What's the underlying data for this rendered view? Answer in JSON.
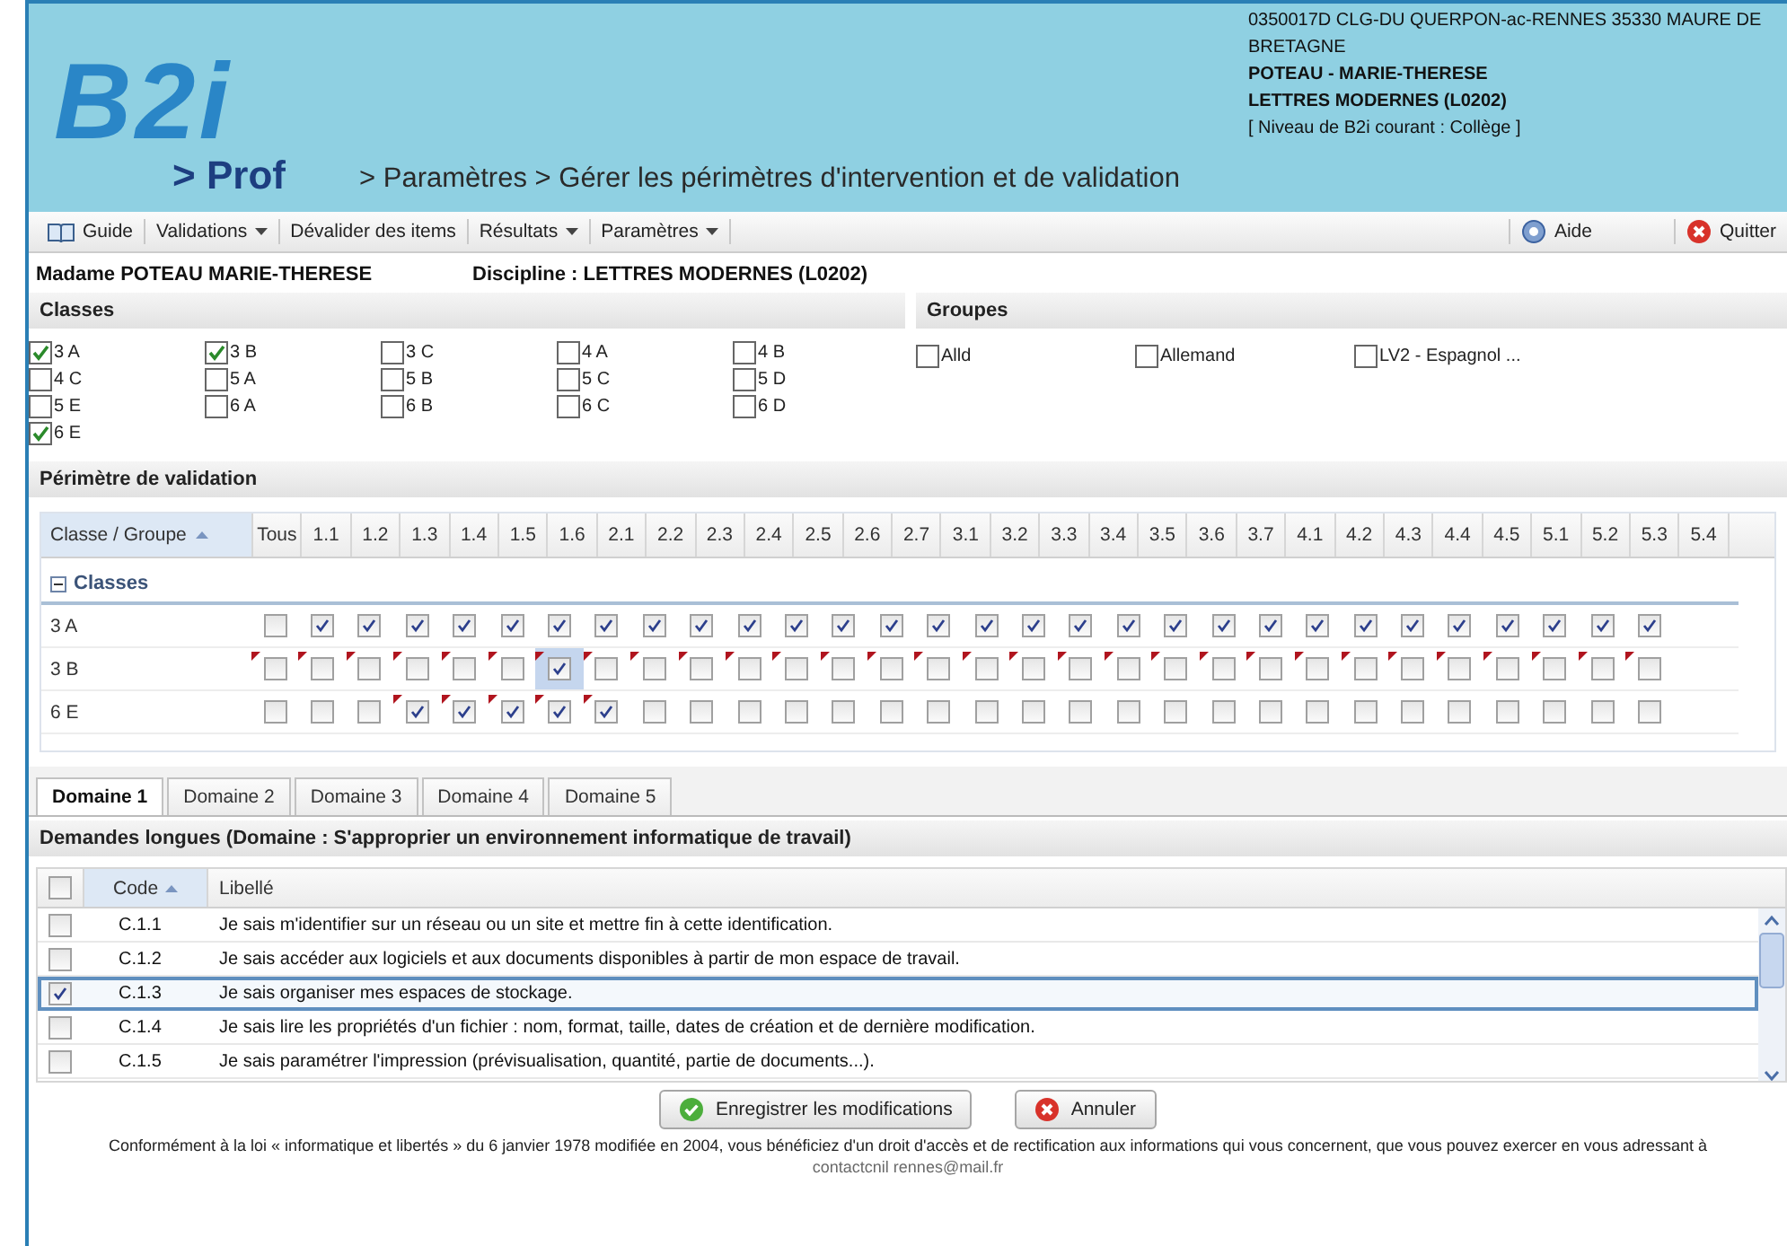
{
  "header": {
    "logo": "B2i",
    "logo_sub": "> Prof",
    "breadcrumb": "> Paramètres > Gérer les périmètres d'intervention et de validation",
    "school": "0350017D CLG-DU QUERPON-ac-RENNES 35330 MAURE DE BRETAGNE",
    "name": "POTEAU - MARIE-THERESE",
    "discipline": "LETTRES MODERNES (L0202)",
    "level": "[ Niveau de B2i courant : Collège ]"
  },
  "toolbar": {
    "left": [
      {
        "label": "Guide",
        "kind": "book"
      },
      {
        "label": "Validations",
        "kind": "menu"
      },
      {
        "label": "Dévalider des items",
        "kind": "plain"
      },
      {
        "label": "Résultats",
        "kind": "menu"
      },
      {
        "label": "Paramètres",
        "kind": "menu"
      }
    ],
    "right": [
      {
        "label": "Aide",
        "kind": "help"
      },
      {
        "label": "Quitter",
        "kind": "quit"
      }
    ]
  },
  "teacher": "Madame POTEAU MARIE-THERESE",
  "discipline": "Discipline : LETTRES MODERNES (L0202)",
  "classes": {
    "title": "Classes",
    "items": [
      {
        "label": "3 A",
        "checked": true
      },
      {
        "label": "3 B",
        "checked": true
      },
      {
        "label": "3 C",
        "checked": false
      },
      {
        "label": "4 A",
        "checked": false
      },
      {
        "label": "4 B",
        "checked": false
      },
      {
        "label": "4 C",
        "checked": false
      },
      {
        "label": "5 A",
        "checked": false
      },
      {
        "label": "5 B",
        "checked": false
      },
      {
        "label": "5 C",
        "checked": false
      },
      {
        "label": "5 D",
        "checked": false
      },
      {
        "label": "5 E",
        "checked": false
      },
      {
        "label": "6 A",
        "checked": false
      },
      {
        "label": "6 B",
        "checked": false
      },
      {
        "label": "6 C",
        "checked": false
      },
      {
        "label": "6 D",
        "checked": false
      },
      {
        "label": "6 E",
        "checked": true
      }
    ]
  },
  "groups": {
    "title": "Groupes",
    "items": [
      {
        "label": "Alld",
        "checked": false
      },
      {
        "label": "Allemand",
        "checked": false
      },
      {
        "label": "LV2 - Espagnol ...",
        "checked": false
      }
    ]
  },
  "validation": {
    "title": "Périmètre de validation",
    "first_column": "Classe / Groupe",
    "columns": [
      "Tous",
      "1.1",
      "1.2",
      "1.3",
      "1.4",
      "1.5",
      "1.6",
      "2.1",
      "2.2",
      "2.3",
      "2.4",
      "2.5",
      "2.6",
      "2.7",
      "3.1",
      "3.2",
      "3.3",
      "3.4",
      "3.5",
      "3.6",
      "3.7",
      "4.1",
      "4.2",
      "4.3",
      "4.4",
      "4.5",
      "5.1",
      "5.2",
      "5.3",
      "5.4"
    ],
    "group": "Classes",
    "rows": [
      {
        "label": "3 A",
        "cells": [
          {
            "checked": false,
            "dirty": false,
            "selected": false
          },
          {
            "checked": true,
            "dirty": false,
            "selected": false
          },
          {
            "checked": true,
            "dirty": false,
            "selected": false
          },
          {
            "checked": true,
            "dirty": false,
            "selected": false
          },
          {
            "checked": true,
            "dirty": false,
            "selected": false
          },
          {
            "checked": true,
            "dirty": false,
            "selected": false
          },
          {
            "checked": true,
            "dirty": false,
            "selected": false
          },
          {
            "checked": true,
            "dirty": false,
            "selected": false
          },
          {
            "checked": true,
            "dirty": false,
            "selected": false
          },
          {
            "checked": true,
            "dirty": false,
            "selected": false
          },
          {
            "checked": true,
            "dirty": false,
            "selected": false
          },
          {
            "checked": true,
            "dirty": false,
            "selected": false
          },
          {
            "checked": true,
            "dirty": false,
            "selected": false
          },
          {
            "checked": true,
            "dirty": false,
            "selected": false
          },
          {
            "checked": true,
            "dirty": false,
            "selected": false
          },
          {
            "checked": true,
            "dirty": false,
            "selected": false
          },
          {
            "checked": true,
            "dirty": false,
            "selected": false
          },
          {
            "checked": true,
            "dirty": false,
            "selected": false
          },
          {
            "checked": true,
            "dirty": false,
            "selected": false
          },
          {
            "checked": true,
            "dirty": false,
            "selected": false
          },
          {
            "checked": true,
            "dirty": false,
            "selected": false
          },
          {
            "checked": true,
            "dirty": false,
            "selected": false
          },
          {
            "checked": true,
            "dirty": false,
            "selected": false
          },
          {
            "checked": true,
            "dirty": false,
            "selected": false
          },
          {
            "checked": true,
            "dirty": false,
            "selected": false
          },
          {
            "checked": true,
            "dirty": false,
            "selected": false
          },
          {
            "checked": true,
            "dirty": false,
            "selected": false
          },
          {
            "checked": true,
            "dirty": false,
            "selected": false
          },
          {
            "checked": true,
            "dirty": false,
            "selected": false
          },
          {
            "checked": true,
            "dirty": false,
            "selected": false
          }
        ]
      },
      {
        "label": "3 B",
        "cells": [
          {
            "checked": false,
            "dirty": true,
            "selected": false
          },
          {
            "checked": false,
            "dirty": true,
            "selected": false
          },
          {
            "checked": false,
            "dirty": true,
            "selected": false
          },
          {
            "checked": false,
            "dirty": true,
            "selected": false
          },
          {
            "checked": false,
            "dirty": true,
            "selected": false
          },
          {
            "checked": false,
            "dirty": true,
            "selected": false
          },
          {
            "checked": true,
            "dirty": true,
            "selected": true
          },
          {
            "checked": false,
            "dirty": true,
            "selected": false
          },
          {
            "checked": false,
            "dirty": true,
            "selected": false
          },
          {
            "checked": false,
            "dirty": true,
            "selected": false
          },
          {
            "checked": false,
            "dirty": true,
            "selected": false
          },
          {
            "checked": false,
            "dirty": true,
            "selected": false
          },
          {
            "checked": false,
            "dirty": true,
            "selected": false
          },
          {
            "checked": false,
            "dirty": true,
            "selected": false
          },
          {
            "checked": false,
            "dirty": true,
            "selected": false
          },
          {
            "checked": false,
            "dirty": true,
            "selected": false
          },
          {
            "checked": false,
            "dirty": true,
            "selected": false
          },
          {
            "checked": false,
            "dirty": true,
            "selected": false
          },
          {
            "checked": false,
            "dirty": true,
            "selected": false
          },
          {
            "checked": false,
            "dirty": true,
            "selected": false
          },
          {
            "checked": false,
            "dirty": true,
            "selected": false
          },
          {
            "checked": false,
            "dirty": true,
            "selected": false
          },
          {
            "checked": false,
            "dirty": true,
            "selected": false
          },
          {
            "checked": false,
            "dirty": true,
            "selected": false
          },
          {
            "checked": false,
            "dirty": true,
            "selected": false
          },
          {
            "checked": false,
            "dirty": true,
            "selected": false
          },
          {
            "checked": false,
            "dirty": true,
            "selected": false
          },
          {
            "checked": false,
            "dirty": true,
            "selected": false
          },
          {
            "checked": false,
            "dirty": true,
            "selected": false
          },
          {
            "checked": false,
            "dirty": true,
            "selected": false
          }
        ]
      },
      {
        "label": "6 E",
        "cells": [
          {
            "checked": false,
            "dirty": false,
            "selected": false
          },
          {
            "checked": false,
            "dirty": false,
            "selected": false
          },
          {
            "checked": false,
            "dirty": false,
            "selected": false
          },
          {
            "checked": true,
            "dirty": true,
            "selected": false
          },
          {
            "checked": true,
            "dirty": true,
            "selected": false
          },
          {
            "checked": true,
            "dirty": true,
            "selected": false
          },
          {
            "checked": true,
            "dirty": true,
            "selected": false
          },
          {
            "checked": true,
            "dirty": true,
            "selected": false
          },
          {
            "checked": false,
            "dirty": false,
            "selected": false
          },
          {
            "checked": false,
            "dirty": false,
            "selected": false
          },
          {
            "checked": false,
            "dirty": false,
            "selected": false
          },
          {
            "checked": false,
            "dirty": false,
            "selected": false
          },
          {
            "checked": false,
            "dirty": false,
            "selected": false
          },
          {
            "checked": false,
            "dirty": false,
            "selected": false
          },
          {
            "checked": false,
            "dirty": false,
            "selected": false
          },
          {
            "checked": false,
            "dirty": false,
            "selected": false
          },
          {
            "checked": false,
            "dirty": false,
            "selected": false
          },
          {
            "checked": false,
            "dirty": false,
            "selected": false
          },
          {
            "checked": false,
            "dirty": false,
            "selected": false
          },
          {
            "checked": false,
            "dirty": false,
            "selected": false
          },
          {
            "checked": false,
            "dirty": false,
            "selected": false
          },
          {
            "checked": false,
            "dirty": false,
            "selected": false
          },
          {
            "checked": false,
            "dirty": false,
            "selected": false
          },
          {
            "checked": false,
            "dirty": false,
            "selected": false
          },
          {
            "checked": false,
            "dirty": false,
            "selected": false
          },
          {
            "checked": false,
            "dirty": false,
            "selected": false
          },
          {
            "checked": false,
            "dirty": false,
            "selected": false
          },
          {
            "checked": false,
            "dirty": false,
            "selected": false
          },
          {
            "checked": false,
            "dirty": false,
            "selected": false
          },
          {
            "checked": false,
            "dirty": false,
            "selected": false
          }
        ]
      }
    ]
  },
  "domain_tabs": [
    {
      "label": "Domaine 1",
      "selected": true
    },
    {
      "label": "Domaine 2",
      "selected": false
    },
    {
      "label": "Domaine 3",
      "selected": false
    },
    {
      "label": "Domaine 4",
      "selected": false
    },
    {
      "label": "Domaine 5",
      "selected": false
    }
  ],
  "demands": {
    "all_checked": false,
    "title": "Demandes longues (Domaine : S'approprier un environnement informatique de travail)",
    "columns": [
      "Code",
      "Libellé"
    ],
    "rows": [
      {
        "code": "C.1.1",
        "label": "Je sais m'identifier sur un réseau ou un site et mettre fin à cette identification.",
        "checked": false,
        "selected": false
      },
      {
        "code": "C.1.2",
        "label": "Je sais accéder aux logiciels et aux documents disponibles à partir de mon espace de travail.",
        "checked": false,
        "selected": false
      },
      {
        "code": "C.1.3",
        "label": "Je sais organiser mes espaces de stockage.",
        "checked": true,
        "selected": true
      },
      {
        "code": "C.1.4",
        "label": "Je sais lire les propriétés d'un fichier : nom, format, taille, dates de création et de dernière modification.",
        "checked": false,
        "selected": false
      },
      {
        "code": "C.1.5",
        "label": "Je sais paramétrer l'impression (prévisualisation, quantité, partie de documents...).",
        "checked": false,
        "selected": false
      }
    ]
  },
  "buttons": [
    {
      "label": "Enregistrer les modifications",
      "kind": "save"
    },
    {
      "label": "Annuler",
      "kind": "cancel"
    }
  ],
  "footer": {
    "text": "Conformément à la loi « informatique et libertés » du 6 janvier 1978 modifiée en 2004, vous bénéficiez d'un droit d'accès et de rectification aux informations qui vous concernent, que vous pouvez exercer en vous adressant à",
    "link": "contactcnil rennes@mail.fr"
  }
}
